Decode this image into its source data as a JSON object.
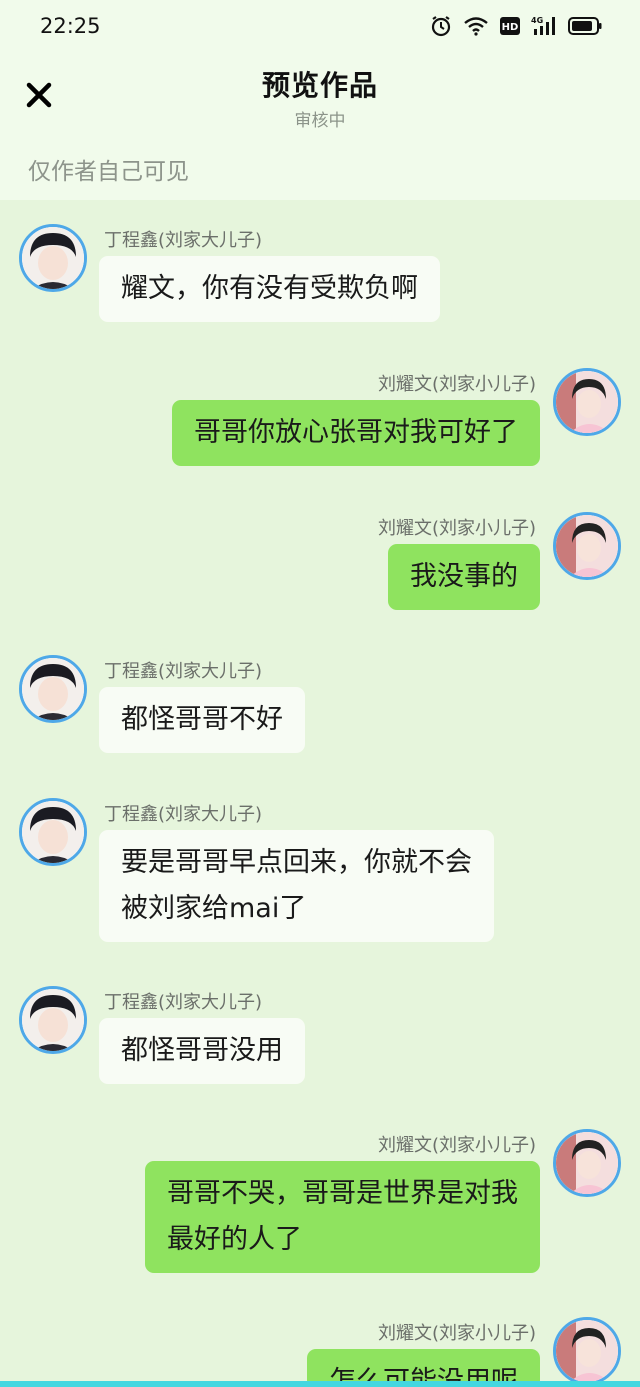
{
  "status_bar": {
    "time": "22:25",
    "icons": [
      "alarm-icon",
      "wifi-icon",
      "hd-icon",
      "4g-signal-icon",
      "battery-icon"
    ],
    "network": "4G",
    "hd_label": "HD"
  },
  "header": {
    "close_icon": "close-icon",
    "title": "预览作品",
    "subtitle": "审核中",
    "visibility_note": "仅作者自己可见"
  },
  "colors": {
    "background": "#e6f5dc",
    "header_bg": "#f1fbeb",
    "self_bubble": "#8fe35f",
    "other_bubble": "#f8fcf5",
    "avatar_ring": "#4ea8e8",
    "bottom_strip": "#43d7e0"
  },
  "messages": [
    {
      "side": "left",
      "name": "丁程鑫(刘家大儿子)",
      "text": "耀文，你有没有受欺负啊"
    },
    {
      "side": "right",
      "name": "刘耀文(刘家小儿子)",
      "text": "哥哥你放心张哥对我可好了"
    },
    {
      "side": "right",
      "name": "刘耀文(刘家小儿子)",
      "text": "我没事的"
    },
    {
      "side": "left",
      "name": "丁程鑫(刘家大儿子)",
      "text": "都怪哥哥不好"
    },
    {
      "side": "left",
      "name": "丁程鑫(刘家大儿子)",
      "text": "要是哥哥早点回来，你就不会\n被刘家给mai了"
    },
    {
      "side": "left",
      "name": "丁程鑫(刘家大儿子)",
      "text": "都怪哥哥没用"
    },
    {
      "side": "right",
      "name": "刘耀文(刘家小儿子)",
      "text": "哥哥不哭，哥哥是世界是对我\n最好的人了"
    },
    {
      "side": "right",
      "name": "刘耀文(刘家小儿子)",
      "text": "怎么可能没用呢"
    }
  ]
}
